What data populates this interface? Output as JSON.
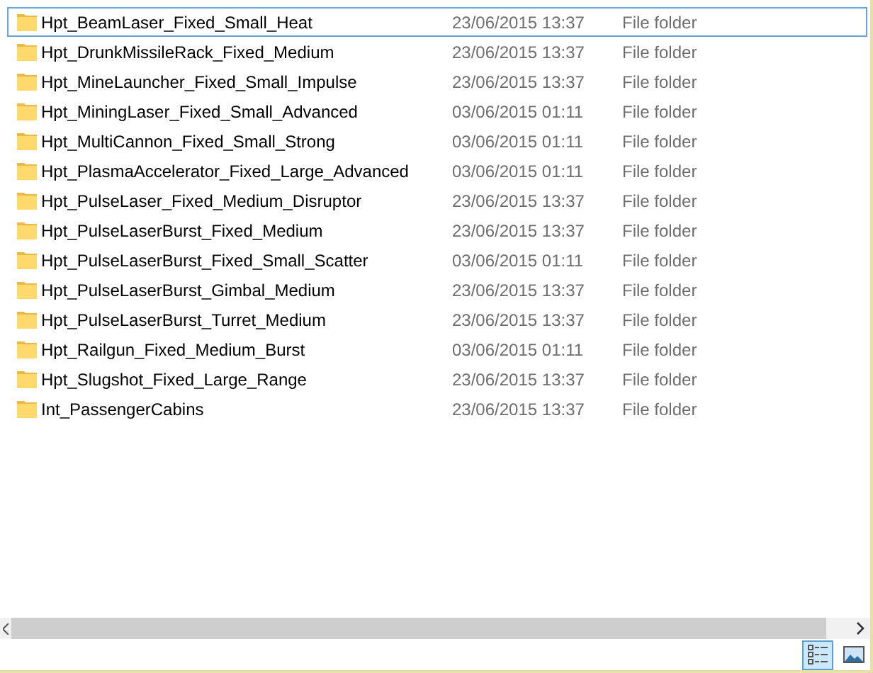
{
  "rows": [
    {
      "name": "Hpt_BeamLaser_Fixed_Small_Heat",
      "date": "23/06/2015 13:37",
      "type": "File folder",
      "selected": true
    },
    {
      "name": "Hpt_DrunkMissileRack_Fixed_Medium",
      "date": "23/06/2015 13:37",
      "type": "File folder",
      "selected": false
    },
    {
      "name": "Hpt_MineLauncher_Fixed_Small_Impulse",
      "date": "23/06/2015 13:37",
      "type": "File folder",
      "selected": false
    },
    {
      "name": "Hpt_MiningLaser_Fixed_Small_Advanced",
      "date": "03/06/2015 01:11",
      "type": "File folder",
      "selected": false
    },
    {
      "name": "Hpt_MultiCannon_Fixed_Small_Strong",
      "date": "03/06/2015 01:11",
      "type": "File folder",
      "selected": false
    },
    {
      "name": "Hpt_PlasmaAccelerator_Fixed_Large_Advanced",
      "date": "03/06/2015 01:11",
      "type": "File folder",
      "selected": false
    },
    {
      "name": "Hpt_PulseLaser_Fixed_Medium_Disruptor",
      "date": "23/06/2015 13:37",
      "type": "File folder",
      "selected": false
    },
    {
      "name": "Hpt_PulseLaserBurst_Fixed_Medium",
      "date": "23/06/2015 13:37",
      "type": "File folder",
      "selected": false
    },
    {
      "name": "Hpt_PulseLaserBurst_Fixed_Small_Scatter",
      "date": "03/06/2015 01:11",
      "type": "File folder",
      "selected": false
    },
    {
      "name": "Hpt_PulseLaserBurst_Gimbal_Medium",
      "date": "23/06/2015 13:37",
      "type": "File folder",
      "selected": false
    },
    {
      "name": "Hpt_PulseLaserBurst_Turret_Medium",
      "date": "23/06/2015 13:37",
      "type": "File folder",
      "selected": false
    },
    {
      "name": "Hpt_Railgun_Fixed_Medium_Burst",
      "date": "03/06/2015 01:11",
      "type": "File folder",
      "selected": false
    },
    {
      "name": "Hpt_Slugshot_Fixed_Large_Range",
      "date": "23/06/2015 13:37",
      "type": "File folder",
      "selected": false
    },
    {
      "name": "Int_PassengerCabins",
      "date": "23/06/2015 13:37",
      "type": "File folder",
      "selected": false
    }
  ],
  "view_buttons": [
    {
      "kind": "details",
      "selected": true
    },
    {
      "kind": "large_icons",
      "selected": false
    }
  ]
}
